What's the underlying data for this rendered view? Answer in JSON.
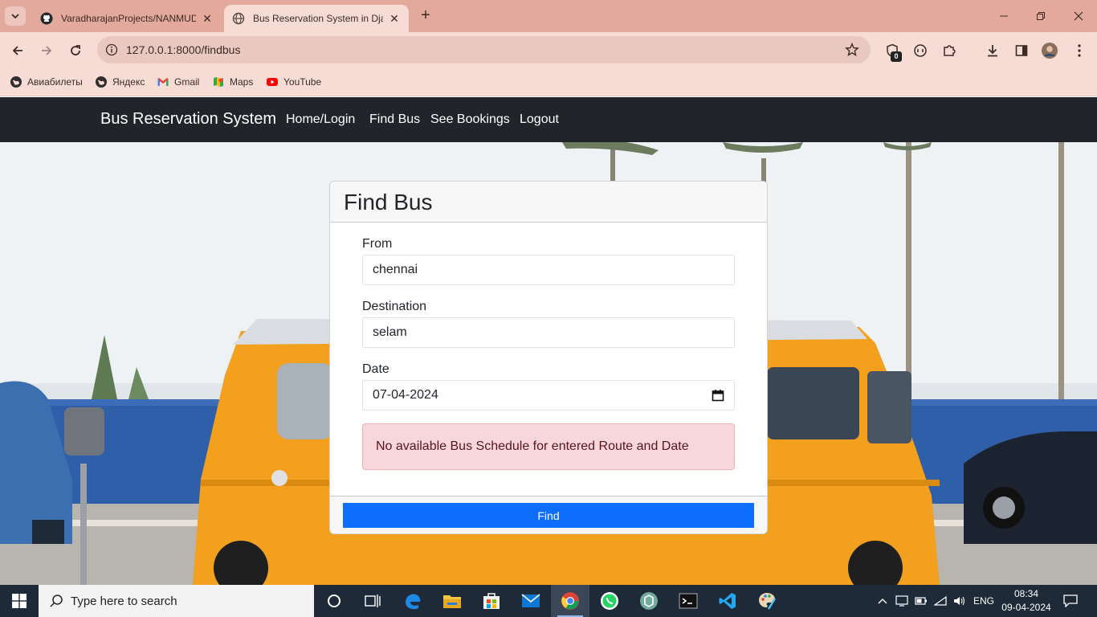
{
  "browser": {
    "tabs": [
      {
        "title": "VaradharajanProjects/NANMUD",
        "icon": "github-icon",
        "active": false
      },
      {
        "title": "Bus Reservation System in Djan",
        "icon": "globe-icon",
        "active": true
      }
    ],
    "url": "127.0.0.1:8000/findbus",
    "extension_badge": "0",
    "bookmarks": [
      {
        "label": "Авиабилеты",
        "icon": "globe-icon"
      },
      {
        "label": "Яндекс",
        "icon": "globe-icon"
      },
      {
        "label": "Gmail",
        "icon": "gmail-icon"
      },
      {
        "label": "Maps",
        "icon": "maps-icon"
      },
      {
        "label": "YouTube",
        "icon": "youtube-icon"
      }
    ]
  },
  "page": {
    "brand": "Bus Reservation System",
    "nav": [
      "Home/Login",
      "Find Bus",
      "See Bookings",
      "Logout"
    ],
    "card": {
      "title": "Find Bus",
      "from_label": "From",
      "from_value": "chennai",
      "destination_label": "Destination",
      "destination_value": "selam",
      "date_label": "Date",
      "date_value": "07-04-2024",
      "alert": "No available Bus Schedule for entered Route and Date",
      "submit_label": "Find"
    }
  },
  "taskbar": {
    "search_placeholder": "Type here to search",
    "language": "ENG",
    "time": "08:34",
    "date": "09-04-2024"
  },
  "colors": {
    "tabstrip": "#e3a99c",
    "toolbar": "#f6dcd5",
    "navbar": "#212529",
    "primary": "#0d6efd",
    "alert_bg": "#f8d7da",
    "taskbar": "#1f2a38"
  }
}
